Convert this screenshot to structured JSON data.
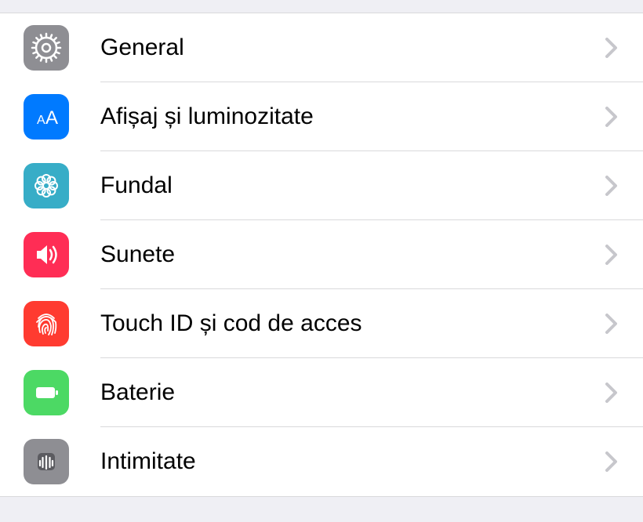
{
  "settings": {
    "items": [
      {
        "label": "General",
        "icon": "gear-icon",
        "bg": "bg-gray"
      },
      {
        "label": "Afișaj și luminozitate",
        "icon": "text-size-icon",
        "bg": "bg-blue"
      },
      {
        "label": "Fundal",
        "icon": "wallpaper-icon",
        "bg": "bg-teal"
      },
      {
        "label": "Sunete",
        "icon": "sound-icon",
        "bg": "bg-red"
      },
      {
        "label": "Touch ID și cod de acces",
        "icon": "fingerprint-icon",
        "bg": "bg-pink"
      },
      {
        "label": "Baterie",
        "icon": "battery-icon",
        "bg": "bg-green"
      },
      {
        "label": "Intimitate",
        "icon": "privacy-icon",
        "bg": "bg-gray2"
      }
    ]
  }
}
